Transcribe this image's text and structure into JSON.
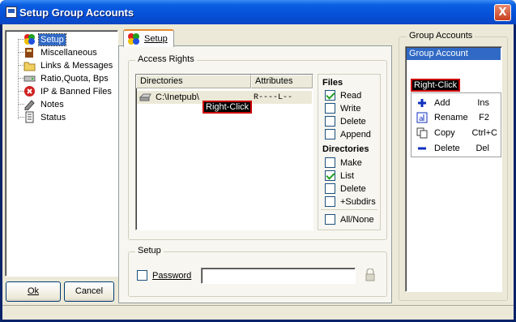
{
  "window": {
    "title": "Setup Group Accounts",
    "close_label": "X"
  },
  "tree": {
    "items": [
      {
        "label": "Setup",
        "icon": "setup-icon",
        "selected": true
      },
      {
        "label": "Miscellaneous",
        "icon": "book-icon"
      },
      {
        "label": "Links & Messages",
        "icon": "folder-icon"
      },
      {
        "label": "Ratio,Quota, Bps",
        "icon": "drive-icon"
      },
      {
        "label": "IP & Banned Files",
        "icon": "banned-icon"
      },
      {
        "label": "Notes",
        "icon": "notes-icon"
      },
      {
        "label": "Status",
        "icon": "status-icon"
      }
    ]
  },
  "buttons": {
    "ok": "Ok",
    "cancel": "Cancel"
  },
  "tab": {
    "label": "Setup"
  },
  "access_rights": {
    "legend": "Access Rights",
    "columns": [
      "Directories",
      "Attributes"
    ],
    "rows": [
      {
        "directory": "C:\\Inetpub\\",
        "attributes": "R----L--"
      }
    ],
    "files_heading": "Files",
    "files": [
      {
        "label": "Read",
        "checked": true
      },
      {
        "label": "Write",
        "checked": false
      },
      {
        "label": "Delete",
        "checked": false
      },
      {
        "label": "Append",
        "checked": false
      }
    ],
    "dirs_heading": "Directories",
    "dirs": [
      {
        "label": "Make",
        "checked": false
      },
      {
        "label": "List",
        "checked": true
      },
      {
        "label": "Delete",
        "checked": false
      },
      {
        "label": "+Subdirs",
        "checked": false
      }
    ],
    "all_none": {
      "label": "All/None",
      "checked": false
    }
  },
  "setup": {
    "legend": "Setup",
    "password_label": "Password",
    "password_value": ""
  },
  "group_accounts": {
    "legend": "Group Accounts",
    "items": [
      "Group Account"
    ]
  },
  "annotations": {
    "right_click_1": "Right-Click",
    "right_click_2": "Right-Click"
  },
  "context_menu": {
    "items": [
      {
        "label": "Add",
        "shortcut": "Ins",
        "icon": "plus-icon"
      },
      {
        "label": "Rename",
        "shortcut": "F2",
        "icon": "rename-icon"
      },
      {
        "label": "Copy",
        "shortcut": "Ctrl+C",
        "icon": "copy-icon"
      },
      {
        "label": "Delete",
        "shortcut": "Del",
        "icon": "minus-icon"
      }
    ]
  }
}
